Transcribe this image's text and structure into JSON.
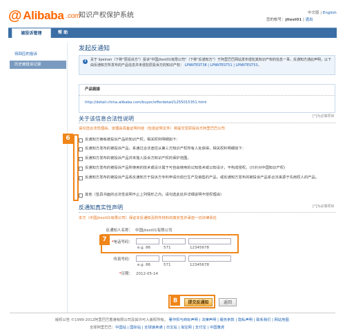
{
  "header": {
    "logo_text": "Alibaba",
    "logo_suffix": ".com",
    "system_title": "知识产权保护系统",
    "lang_cn": "中文版",
    "lang_sep": " | ",
    "lang_en": "English",
    "login_prefix": "您的帐号：",
    "login_user": "jitest01",
    "login_sep": " | ",
    "logout": "退出"
  },
  "nav": {
    "tabs": [
      {
        "label": "被投诉管理"
      },
      {
        "label": "帮 助"
      }
    ]
  },
  "sidebar": {
    "items": [
      {
        "label": "待回应的投诉"
      },
      {
        "label": "历史被投诉记录"
      }
    ]
  },
  "main": {
    "section_title": "发起反通知",
    "info_text": "关于 lipeinan（下称\"原投诉方\"）投诉\"中国jitest01有限公司\"（下称\"反通知方\"）于阿里巴巴网站发布侵犯其知识产权的信息一事，反通知方通此声明，以下由反通知方所发布的产品信息并未侵犯原投诉方的知识产权：",
    "info_links": "LPNNTEST38 | LPNNTEST51 | LPNNTEST53",
    "info_tail": "。",
    "product_link_label": "产品链接",
    "product_url": "http://detail.china.alibaba.com/buyer/offerdetail/1255015351.html"
  },
  "legal": {
    "title": "关于该信息合法性说明",
    "required_note": "[*]为必填项目",
    "instruction": "请勾选合法性理由，该理由具备证明内容（包括证明文件）将提交至原投诉方阿里巴巴公司",
    "item1": "反通知方拥有被投诉产品的知识产权，相关权利明细如下：",
    "item2": "反通知方发布的被投诉产品，系通过合法途径从第三方知识产权所有人处获得，相关权利明细如下：",
    "item3": "反通知方发布的被投诉产品并未落入投诉方知识产权的保护范围。",
    "item4": "反通知方发布的被投诉产品所使用的技术或设计属于可自由使用的公知技术或公知设计，不构成侵权。(只针对中国知识产权)",
    "item5": "反通知方发布的被投诉产品系反通知方于投诉方专利申请日前已生产及销售的产品，或反通知方发布的被投诉产品系合法来源于先用权人的产品。",
    "item6": "其他（签具书面的合法性说明不止上列情形之内，请勾选此处并详细说明不侵权理由）"
  },
  "statement": {
    "title": "反通知真实性声明",
    "required_note": "[*]为必填项目",
    "declaration": "本方（中国jitest01有限公司）保证本反通知及附件材料的真实性并承担一切法律责任",
    "sender_label": "反通知人名称：",
    "sender_value": "中国jitest01有限公司",
    "phone_label": "电话号码：",
    "phone_hint_country": "e.g. 86",
    "phone_hint_area": "571",
    "phone_hint_number": "12345678",
    "fax_label": "传真号码：",
    "fax_hint_country": "e.g. 86",
    "fax_hint_area": "571",
    "fax_hint_number": "12345678",
    "date_label": "日期：",
    "date_value": "2012-05-14",
    "required_star": "*"
  },
  "buttons": {
    "submit": "提交反通知",
    "back": "返回"
  },
  "badges": {
    "b6": "6",
    "b7": "7",
    "b8": "8"
  },
  "footer": {
    "copyright": "版权公告 ©1999-2012阿里巴巴香港有限公司及其许可人版权所有。",
    "links1": "著作权与商标声明 | 法律声明 | 服务条款 | 隐私声明 | 联系我们 | 网站地图",
    "links2_prefix": "全球阿里巴巴：",
    "links2": "中国站 | 国际站 | 全球速卖通 | 日文站 | 淘宝网 | 支付宝 | 中国雅虎"
  },
  "colors": {
    "brand": "#ff6600",
    "nav": "#3a6ea5",
    "highlight": "#f08519",
    "link": "#1a5fb4"
  }
}
